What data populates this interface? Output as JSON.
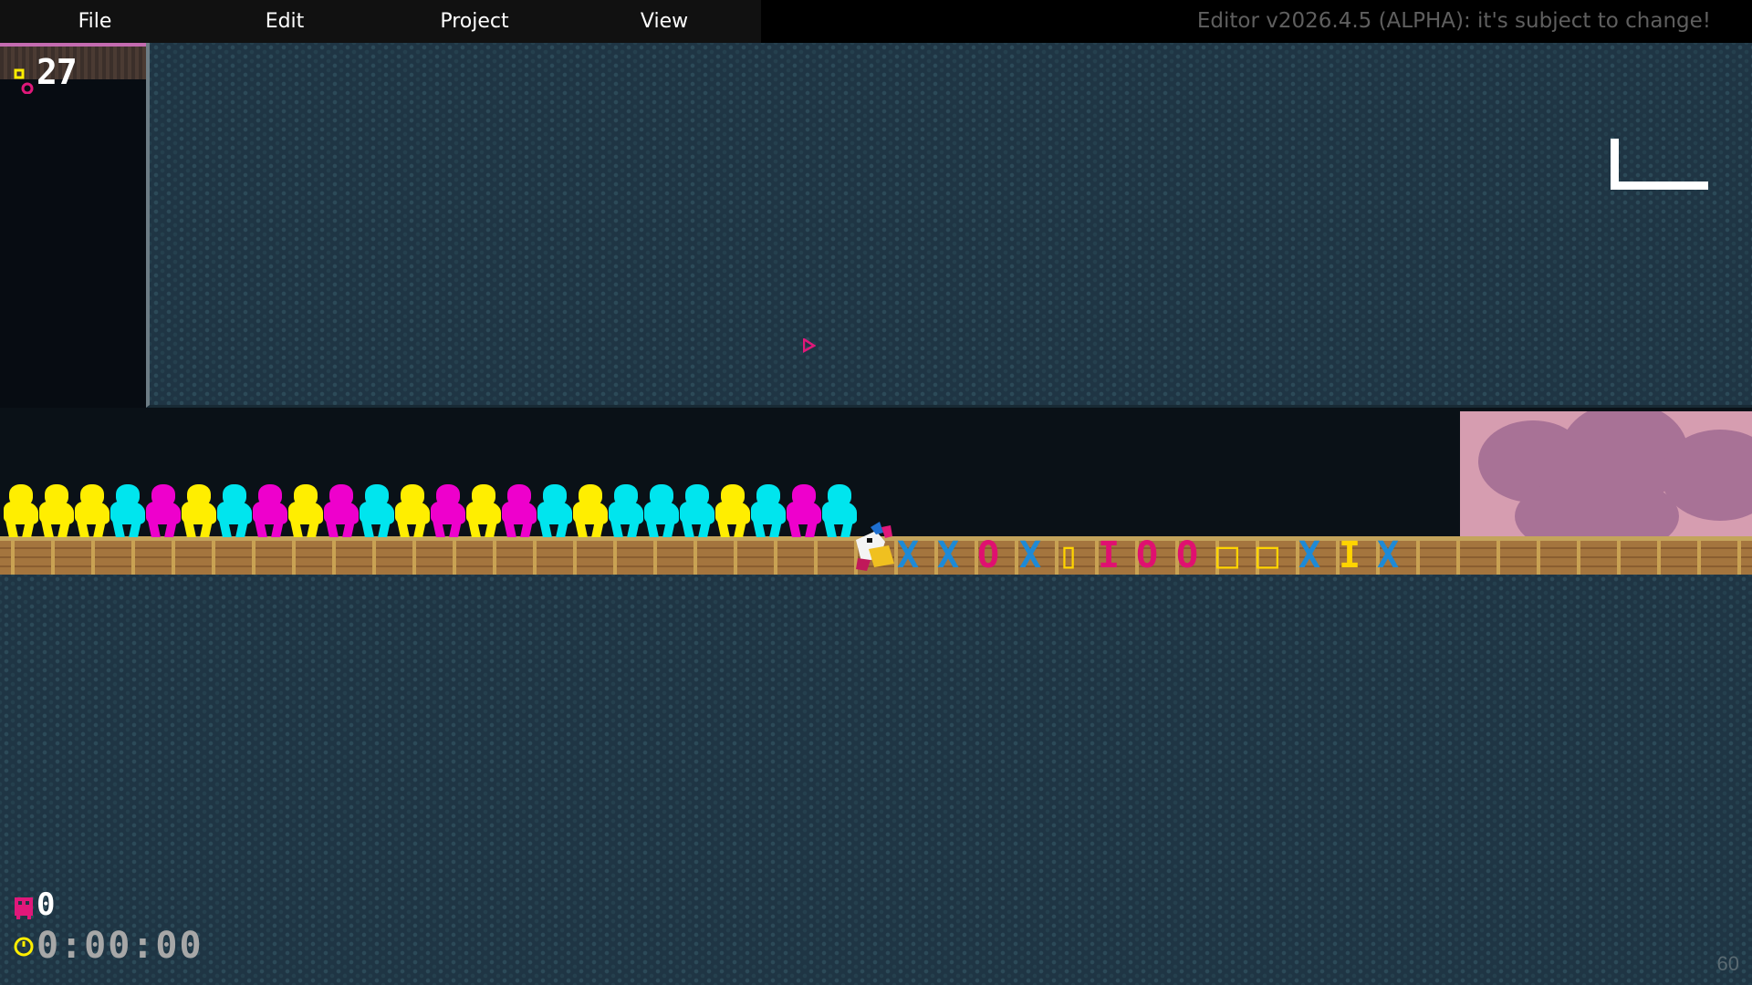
{
  "menu": {
    "items": [
      {
        "label": "File"
      },
      {
        "label": "Edit"
      },
      {
        "label": "Project"
      },
      {
        "label": "View"
      }
    ],
    "version_text": "Editor v2026.4.5 (ALPHA): it's subject to change!"
  },
  "hud": {
    "coin_count": "27",
    "death_count": "0",
    "timer": "0:00:00",
    "fps": "60"
  },
  "colors": {
    "yellow": "#ffee00",
    "cyan": "#00e5ee",
    "magenta": "#ee00cc",
    "blue_glyph": "#1e8ad6",
    "pink_glyph": "#e01070",
    "gold_glyph": "#ffd400"
  },
  "crowd": [
    "yellow",
    "yellow",
    "yellow",
    "cyan",
    "magenta",
    "yellow",
    "cyan",
    "magenta",
    "yellow",
    "magenta",
    "cyan",
    "yellow",
    "magenta",
    "yellow",
    "magenta",
    "cyan",
    "yellow",
    "cyan",
    "cyan",
    "cyan",
    "yellow",
    "cyan",
    "magenta",
    "cyan"
  ],
  "glyphs": [
    {
      "char": "X",
      "color": "blue_glyph"
    },
    {
      "char": "X",
      "color": "blue_glyph"
    },
    {
      "char": "O",
      "color": "pink_glyph"
    },
    {
      "char": "X",
      "color": "blue_glyph"
    },
    {
      "char": "▯",
      "color": "gold_glyph"
    },
    {
      "char": "I",
      "color": "pink_glyph"
    },
    {
      "char": "O",
      "color": "pink_glyph"
    },
    {
      "char": "O",
      "color": "pink_glyph"
    },
    {
      "char": "□",
      "color": "gold_glyph"
    },
    {
      "char": "□",
      "color": "gold_glyph"
    },
    {
      "char": "X",
      "color": "blue_glyph"
    },
    {
      "char": "I",
      "color": "gold_glyph"
    },
    {
      "char": "X",
      "color": "blue_glyph"
    }
  ]
}
